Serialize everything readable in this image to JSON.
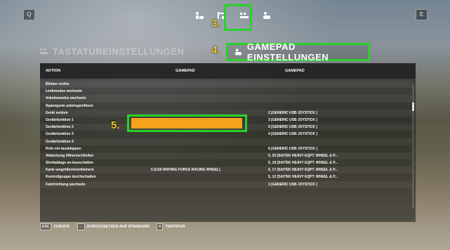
{
  "window": {
    "left_key": "Q",
    "right_key": "E"
  },
  "tabs": [
    {
      "icon": "person-keyboard-icon",
      "active": false
    },
    {
      "icon": "controls-icon",
      "active": false
    },
    {
      "icon": "keyboard-icon",
      "active": true
    },
    {
      "icon": "gamepad-person-icon",
      "active": false
    }
  ],
  "annotations": {
    "step3": "3.",
    "step4": "4.",
    "step5": "5."
  },
  "headings": {
    "left": "TASTATUREINSTELLUNGEN",
    "right": "GAMEPAD EINSTELLUNGEN"
  },
  "table": {
    "headers": [
      "AKTION",
      "GAMEPAD",
      "GAMEPAD"
    ],
    "rows": [
      [
        "Blinker rechts",
        "",
        ""
      ],
      [
        "Lenkmodus wechseln",
        "",
        ""
      ],
      [
        "Arbeitsmodus wechseln",
        "",
        ""
      ],
      [
        "Spanngurte anbringen/lösen",
        "",
        ""
      ],
      [
        "Gerät senken",
        "",
        "2 [GENERIC  USB  JOYSTICK ]"
      ],
      [
        "Gerätefunktion 1",
        "",
        "3 [GENERIC  USB  JOYSTICK ]"
      ],
      [
        "Gerätefunktion 2",
        "",
        "5 [GENERIC  USB  JOYSTICK ]"
      ],
      [
        "Gerätefunktion 3",
        "",
        "4 [GENERIC  USB  JOYSTICK ]"
      ],
      [
        "Gerätefunktion 4",
        "",
        ""
      ],
      [
        "Rohr ein-/ausklappen",
        "",
        "6 [GENERIC  USB  JOYSTICK ]"
      ],
      [
        "Abdeckung öffnen/schließen",
        "",
        "5, 20 [SAITEK HEAVY EQPT. WHEEL & P..."
      ],
      [
        "Strohablage an-/ausschalten",
        "",
        "5, 18 [SAITEK HEAVY EQPT. WHEEL & P..."
      ],
      [
        "Karte vergrößern/verkleinern",
        "5 [G29 DRIVING FORCE RACING WHEEL]",
        "5, 17 [SAITEK HEAVY EQPT. WHEEL & P..."
      ],
      [
        "Kontrollgruppe durchschalten",
        "",
        "5, 12 [SAITEK HEAVY EQPT. WHEEL & P..."
      ],
      [
        "Fahrtrichtung wechseln",
        "",
        "3 [GENERIC  USB  JOYSTICK ]"
      ]
    ]
  },
  "footer": {
    "back_key": "ESC",
    "back_label": "ZURÜCK",
    "reset_key": "⇔",
    "reset_label": "ZURÜCKSETZEN AUF STANDARD",
    "keyboard_key": "X",
    "keyboard_label": "TASTATUR"
  },
  "colors": {
    "highlight": "#2ad12a",
    "selected_slot": "#f7a21c",
    "annotation": "#f0c51e"
  }
}
